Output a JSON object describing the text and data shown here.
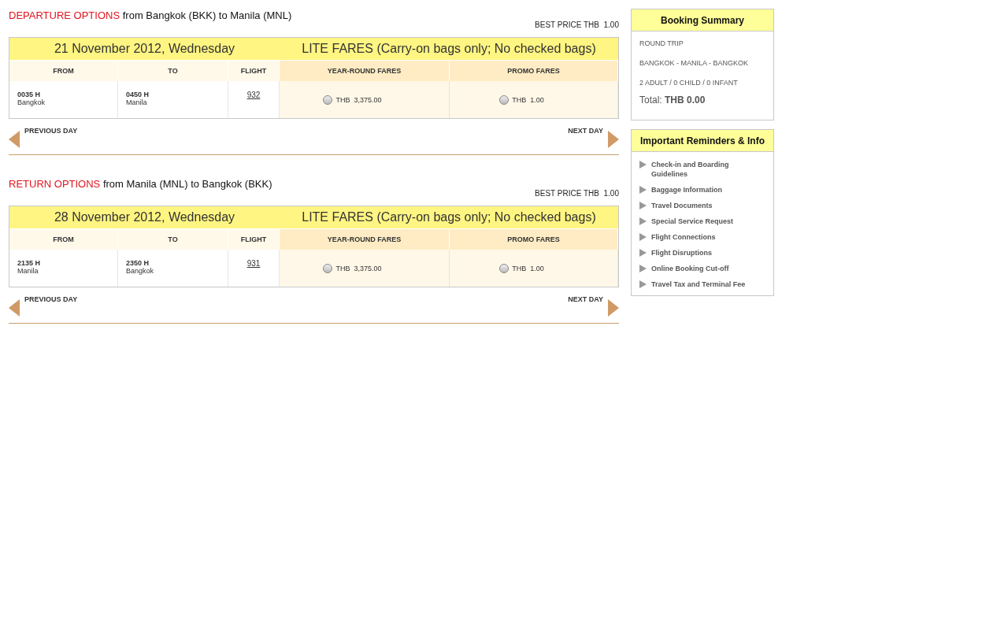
{
  "sections": [
    {
      "title_strong": "DEPARTURE OPTIONS",
      "title_rest": "from Bangkok (BKK) to Manila (MNL)",
      "best_price": "BEST PRICE THB  1.00",
      "date": "21 November 2012, Wednesday",
      "fare_title": "LITE FARES (Carry-on bags only; No checked bags)",
      "columns": [
        "FROM",
        "TO",
        "FLIGHT",
        "YEAR-ROUND FARES",
        "PROMO FARES"
      ],
      "rows": [
        {
          "from_time": "0035 H",
          "from_city": "Bangkok",
          "to_time": "0450 H",
          "to_city": "Manila",
          "flight": "932",
          "fares": [
            {
              "label": "THB  3,375.00",
              "selected": false
            },
            {
              "label": "THB  1.00",
              "selected": false
            }
          ]
        }
      ],
      "previous": "PREVIOUS DAY",
      "next": "NEXT DAY"
    },
    {
      "title_strong": "RETURN OPTIONS",
      "title_rest": "from Manila (MNL) to Bangkok (BKK)",
      "best_price": "BEST PRICE THB  1.00",
      "date": "28 November 2012, Wednesday",
      "fare_title": "LITE FARES (Carry-on bags only; No checked bags)",
      "columns": [
        "FROM",
        "TO",
        "FLIGHT",
        "YEAR-ROUND FARES",
        "PROMO FARES"
      ],
      "rows": [
        {
          "from_time": "2135 H",
          "from_city": "Manila",
          "to_time": "2350 H",
          "to_city": "Bangkok",
          "flight": "931",
          "fares": [
            {
              "label": "THB  3,375.00",
              "selected": false
            },
            {
              "label": "THB  1.00",
              "selected": false
            }
          ]
        }
      ],
      "previous": "PREVIOUS DAY",
      "next": "NEXT DAY"
    }
  ],
  "summary": {
    "title": "Booking Summary",
    "lines": [
      "ROUND TRIP",
      "BANGKOK - MANILA - BANGKOK",
      "2 ADULT / 0 CHILD / 0 INFANT"
    ],
    "total_label": "Total:",
    "total_value": "THB 0.00"
  },
  "reminders": {
    "title": "Important Reminders & Info",
    "items": [
      "Check-in and Boarding Guidelines",
      "Baggage Information",
      "Travel Documents",
      "Special Service Request",
      "Flight Connections",
      "Flight Disruptions",
      "Online Booking Cut-off",
      "Travel Tax and Terminal Fee"
    ]
  }
}
